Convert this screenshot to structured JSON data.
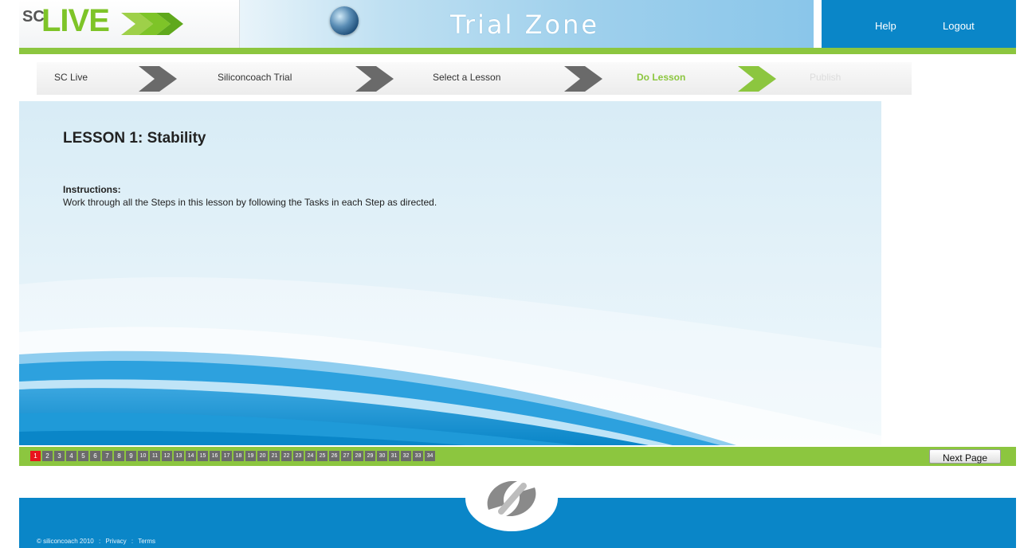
{
  "header": {
    "logo_sc": "SC",
    "logo_live": "LIVE",
    "zone_title": "Trial Zone",
    "help_label": "Help",
    "logout_label": "Logout"
  },
  "breadcrumb": [
    {
      "label": "SC Live",
      "state": "normal"
    },
    {
      "label": "Siliconcoach Trial",
      "state": "normal"
    },
    {
      "label": "Select a Lesson",
      "state": "normal"
    },
    {
      "label": "Do Lesson",
      "state": "active"
    },
    {
      "label": "Publish",
      "state": "disabled"
    }
  ],
  "lesson": {
    "title": "LESSON 1: Stability",
    "instructions_label": "Instructions:",
    "instructions_text": "Work through all the Steps in this lesson by following the Tasks in each Step as directed."
  },
  "pager": {
    "current": 1,
    "pages": [
      "1",
      "2",
      "3",
      "4",
      "5",
      "6",
      "7",
      "8",
      "9",
      "10",
      "11",
      "12",
      "13",
      "14",
      "15",
      "16",
      "17",
      "18",
      "19",
      "20",
      "21",
      "22",
      "23",
      "24",
      "25",
      "26",
      "27",
      "28",
      "29",
      "30",
      "31",
      "32",
      "33",
      "34"
    ],
    "next_label": "Next Page"
  },
  "footer": {
    "copyright": "© siliconcoach 2010",
    "sep1": ":",
    "privacy": "Privacy",
    "sep2": ":",
    "terms": "Terms"
  },
  "colors": {
    "accent_green": "#8cc63f",
    "brand_blue": "#0a86c8",
    "current_page_red": "#e8151c",
    "page_grey": "#6b6b6b"
  },
  "icons": [
    "globe-icon",
    "step-arrow-icon",
    "siliconcoach-logo-icon",
    "live-arrows-icon"
  ]
}
